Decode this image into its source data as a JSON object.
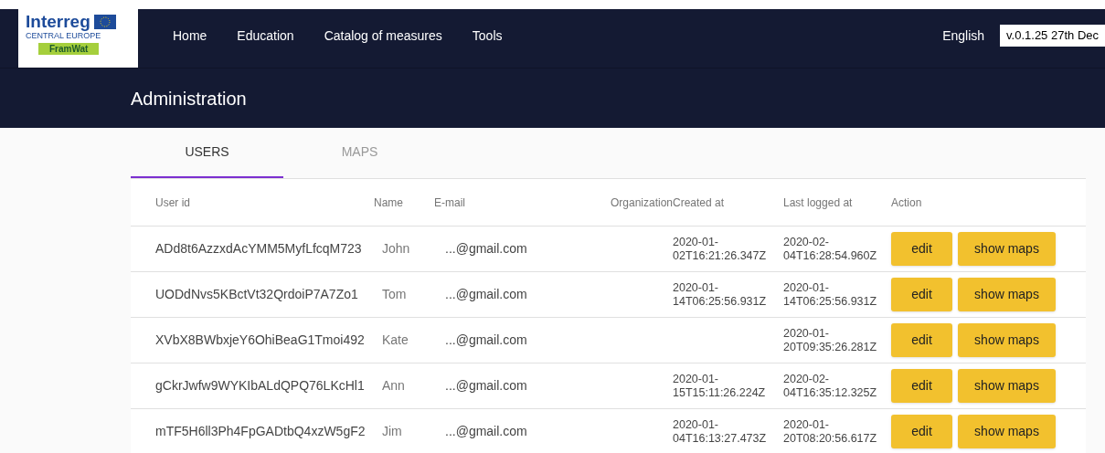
{
  "logo": {
    "title": "Interreg",
    "subtitle": "CENTRAL EUROPE",
    "project": "FramWat"
  },
  "nav": [
    "Home",
    "Education",
    "Catalog of measures",
    "Tools"
  ],
  "language": "English",
  "version": "v.0.1.25 27th Dec",
  "page_title": "Administration",
  "tabs": [
    {
      "label": "USERS",
      "selected": true
    },
    {
      "label": "MAPS",
      "selected": false
    }
  ],
  "table": {
    "columns": [
      "User id",
      "Name",
      "E-mail",
      "Organization",
      "Created at",
      "Last logged at",
      "Action"
    ],
    "rows": [
      {
        "user_id": "ADd8t6AzzxdAcYMM5MyfLfcqM723",
        "name": "John",
        "email": "...@gmail.com",
        "created_at": "2020-01-02T16:21:26.347Z",
        "last_logged_at": "2020-02-04T16:28:54.960Z",
        "actions": [
          "edit",
          "show maps"
        ]
      },
      {
        "user_id": "UODdNvs5KBctVt32QrdoiP7A7Zo1",
        "name": "Tom",
        "email": "...@gmail.com",
        "created_at": "2020-01-14T06:25:56.931Z",
        "last_logged_at": "2020-01-14T06:25:56.931Z",
        "actions": [
          "edit",
          "show maps"
        ]
      },
      {
        "user_id": "XVbX8BWbxjeY6OhiBeaG1Tmoi492",
        "name": "Kate",
        "email": "...@gmail.com",
        "last_logged_at": "2020-01-20T09:35:26.281Z",
        "actions": [
          "edit",
          "show maps"
        ]
      },
      {
        "user_id": "gCkrJwfw9WYKIbALdQPQ76LKcHl1",
        "name": "Ann",
        "email": "...@gmail.com",
        "created_at": "2020-01-15T15:11:26.224Z",
        "last_logged_at": "2020-02-04T16:35:12.325Z",
        "actions": [
          "edit",
          "show maps"
        ]
      },
      {
        "user_id": "mTF5H6ll3Ph4FpGADtbQ4xzW5gF2",
        "name": "Jim",
        "email": "...@gmail.com",
        "created_at": "2020-01-04T16:13:27.473Z",
        "last_logged_at": "2020-01-20T08:20:56.617Z",
        "actions": [
          "edit",
          "show maps"
        ]
      }
    ]
  }
}
